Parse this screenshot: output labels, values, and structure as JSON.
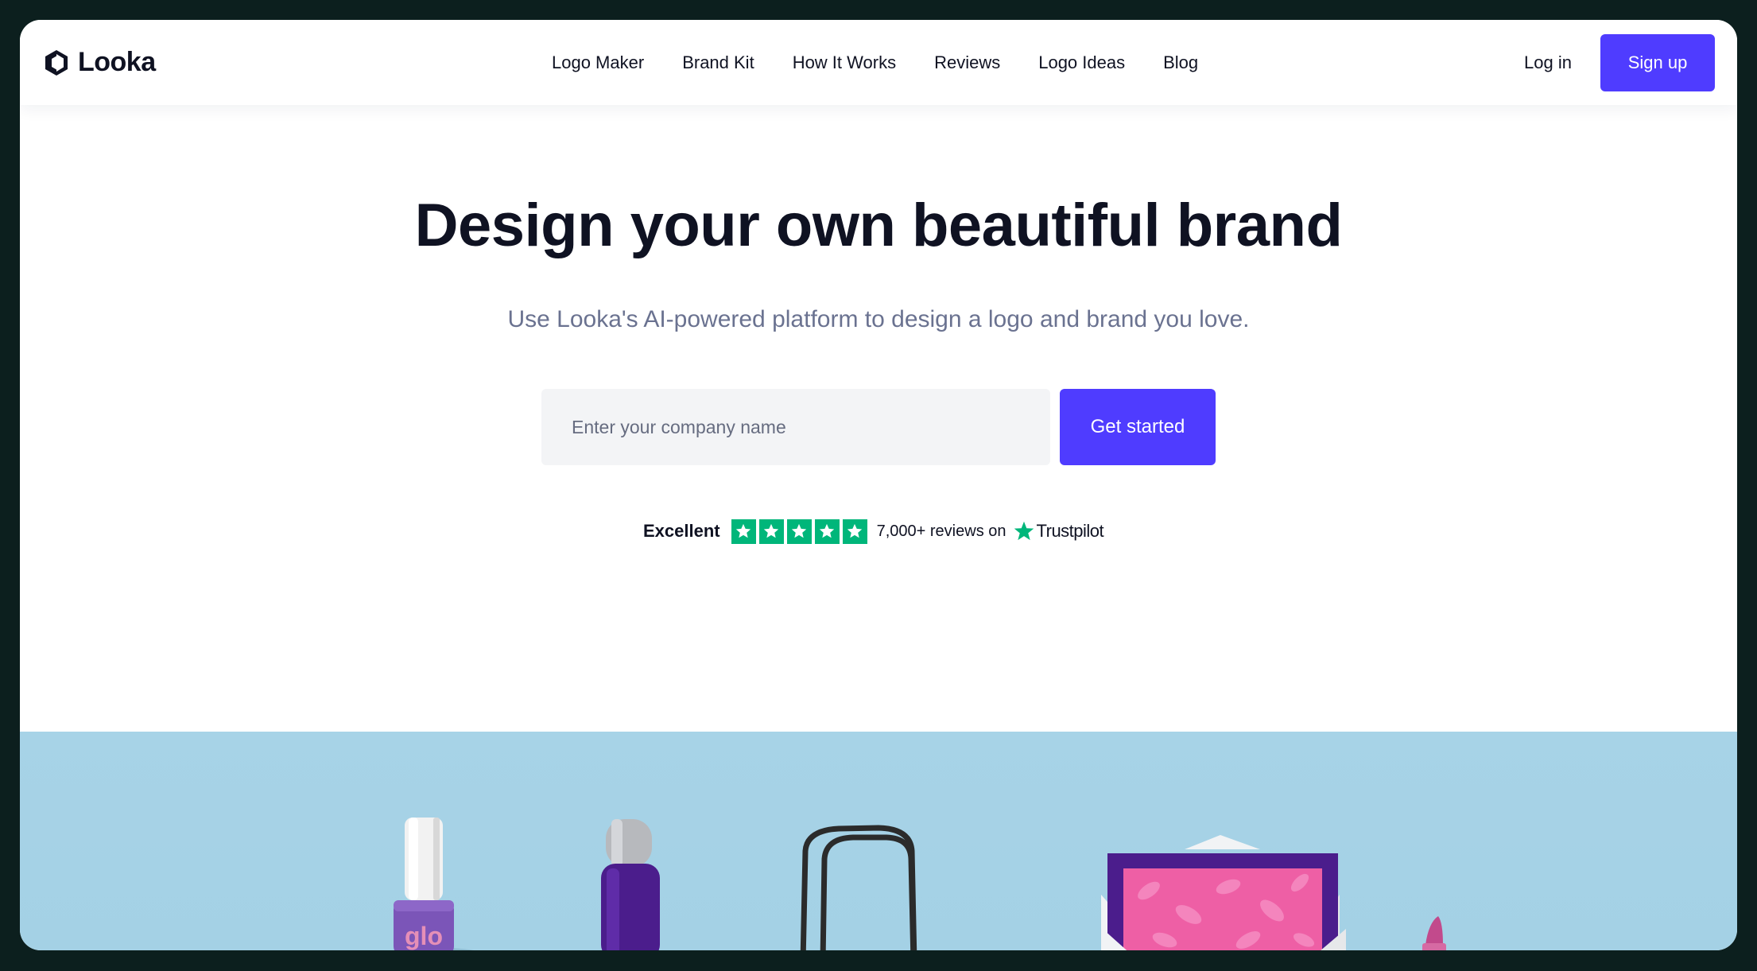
{
  "brand": {
    "name": "Looka",
    "icon": "looka-logo-icon"
  },
  "nav": {
    "items": [
      {
        "label": "Logo Maker"
      },
      {
        "label": "Brand Kit"
      },
      {
        "label": "How It Works"
      },
      {
        "label": "Reviews"
      },
      {
        "label": "Logo Ideas"
      },
      {
        "label": "Blog"
      }
    ]
  },
  "header_actions": {
    "login": "Log in",
    "signup": "Sign up"
  },
  "hero": {
    "title": "Design your own beautiful brand",
    "subtitle": "Use Looka's AI-powered platform to design a logo and brand you love.",
    "input_placeholder": "Enter your company name",
    "input_value": "",
    "cta": "Get started"
  },
  "trustpilot": {
    "rating_label": "Excellent",
    "stars": 5,
    "reviews": "7,000+ reviews on",
    "provider": "Trustpilot",
    "star_icon": "star-icon"
  },
  "showcase": {
    "items": [
      "nail-polish-bottle",
      "spray-bottle",
      "shopping-bag",
      "envelope-card",
      "lipstick"
    ],
    "bottle_label": "glo"
  },
  "colors": {
    "accent": "#4f3cff",
    "trustpilot_green": "#00b67a",
    "showcase_bg": "#a7d3e7",
    "text_dark": "#0f1222",
    "text_muted": "#6a7290",
    "input_bg": "#f3f4f6",
    "frame": "#0c1f1e"
  }
}
